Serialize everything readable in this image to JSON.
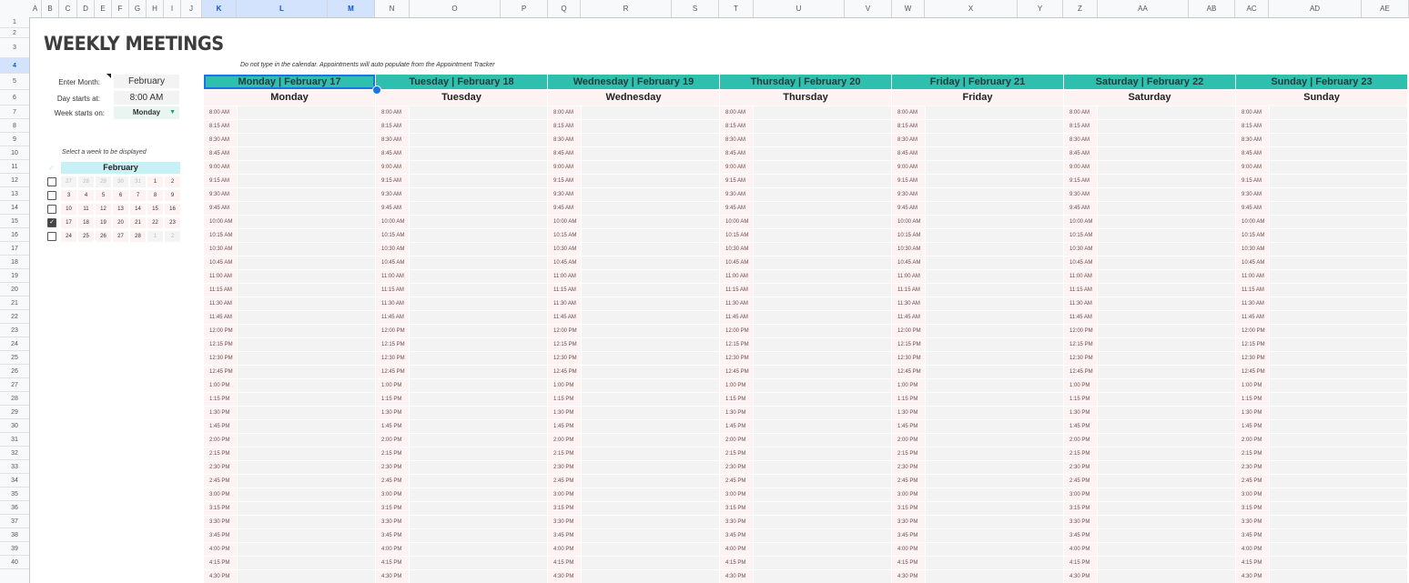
{
  "sheet": {
    "columns": [
      "A",
      "B",
      "C",
      "D",
      "E",
      "F",
      "G",
      "H",
      "I",
      "J",
      "K",
      "L",
      "M",
      "N",
      "O",
      "P",
      "Q",
      "R",
      "S",
      "T",
      "U",
      "V",
      "W",
      "X",
      "Y",
      "Z",
      "AA",
      "AB",
      "AC",
      "AD",
      "AE"
    ],
    "selected_columns": [
      "K",
      "L",
      "M"
    ],
    "rows": [
      "1",
      "2",
      "3",
      "4",
      "5",
      "6",
      "7",
      "8",
      "9",
      "10",
      "11",
      "12",
      "13",
      "14",
      "15",
      "16",
      "17",
      "18",
      "19",
      "20",
      "21",
      "22",
      "23",
      "24",
      "25",
      "26",
      "27",
      "28",
      "29",
      "30",
      "31",
      "32",
      "33",
      "34",
      "35",
      "36",
      "37",
      "38",
      "39",
      "40"
    ],
    "selected_row": "4"
  },
  "title": "WEEKLY MEETINGS",
  "note": "Do not type in the calendar. Appointments will auto populate from the Appointment Tracker",
  "controls": {
    "month_label": "Enter Month:",
    "month_value": "February",
    "start_label": "Day starts at:",
    "start_value": "8:00 AM",
    "week_label": "Week starts on:",
    "week_value": "Monday"
  },
  "mini_calendar": {
    "instruction": "Select a week to be displayed",
    "check_glyph": "✓",
    "month": "February",
    "weeks": [
      {
        "checked": false,
        "days": [
          "27",
          "28",
          "29",
          "30",
          "31",
          "1",
          "2"
        ],
        "dim": [
          true,
          true,
          true,
          true,
          true,
          false,
          false
        ]
      },
      {
        "checked": false,
        "days": [
          "3",
          "4",
          "5",
          "6",
          "7",
          "8",
          "9"
        ],
        "dim": [
          false,
          false,
          false,
          false,
          false,
          false,
          false
        ]
      },
      {
        "checked": false,
        "days": [
          "10",
          "11",
          "12",
          "13",
          "14",
          "15",
          "16"
        ],
        "dim": [
          false,
          false,
          false,
          false,
          false,
          false,
          false
        ]
      },
      {
        "checked": true,
        "days": [
          "17",
          "18",
          "19",
          "20",
          "21",
          "22",
          "23"
        ],
        "dim": [
          false,
          false,
          false,
          false,
          false,
          false,
          false
        ]
      },
      {
        "checked": false,
        "days": [
          "24",
          "25",
          "26",
          "27",
          "28",
          "1",
          "2"
        ],
        "dim": [
          false,
          false,
          false,
          false,
          false,
          true,
          true
        ]
      }
    ]
  },
  "calendar": {
    "days": [
      {
        "header": "Monday | February 17",
        "name": "Monday"
      },
      {
        "header": "Tuesday | February 18",
        "name": "Tuesday"
      },
      {
        "header": "Wednesday | February 19",
        "name": "Wednesday"
      },
      {
        "header": "Thursday | February 20",
        "name": "Thursday"
      },
      {
        "header": "Friday | February 21",
        "name": "Friday"
      },
      {
        "header": "Saturday | February 22",
        "name": "Saturday"
      },
      {
        "header": "Sunday | February 23",
        "name": "Sunday"
      }
    ],
    "times": [
      "8:00 AM",
      "8:15 AM",
      "8:30 AM",
      "8:45 AM",
      "9:00 AM",
      "9:15 AM",
      "9:30 AM",
      "9:45 AM",
      "10:00 AM",
      "10:15 AM",
      "10:30 AM",
      "10:45 AM",
      "11:00 AM",
      "11:15 AM",
      "11:30 AM",
      "11:45 AM",
      "12:00 PM",
      "12:15 PM",
      "12:30 PM",
      "12:45 PM",
      "1:00 PM",
      "1:15 PM",
      "1:30 PM",
      "1:45 PM",
      "2:00 PM",
      "2:15 PM",
      "2:30 PM",
      "2:45 PM",
      "3:00 PM",
      "3:15 PM",
      "3:30 PM",
      "3:45 PM",
      "4:00 PM",
      "4:15 PM",
      "4:30 PM"
    ]
  },
  "colors": {
    "day_header_bg": "#2fbfae",
    "mini_header_bg": "#c8f1f5",
    "selection": "#1a73e8"
  }
}
